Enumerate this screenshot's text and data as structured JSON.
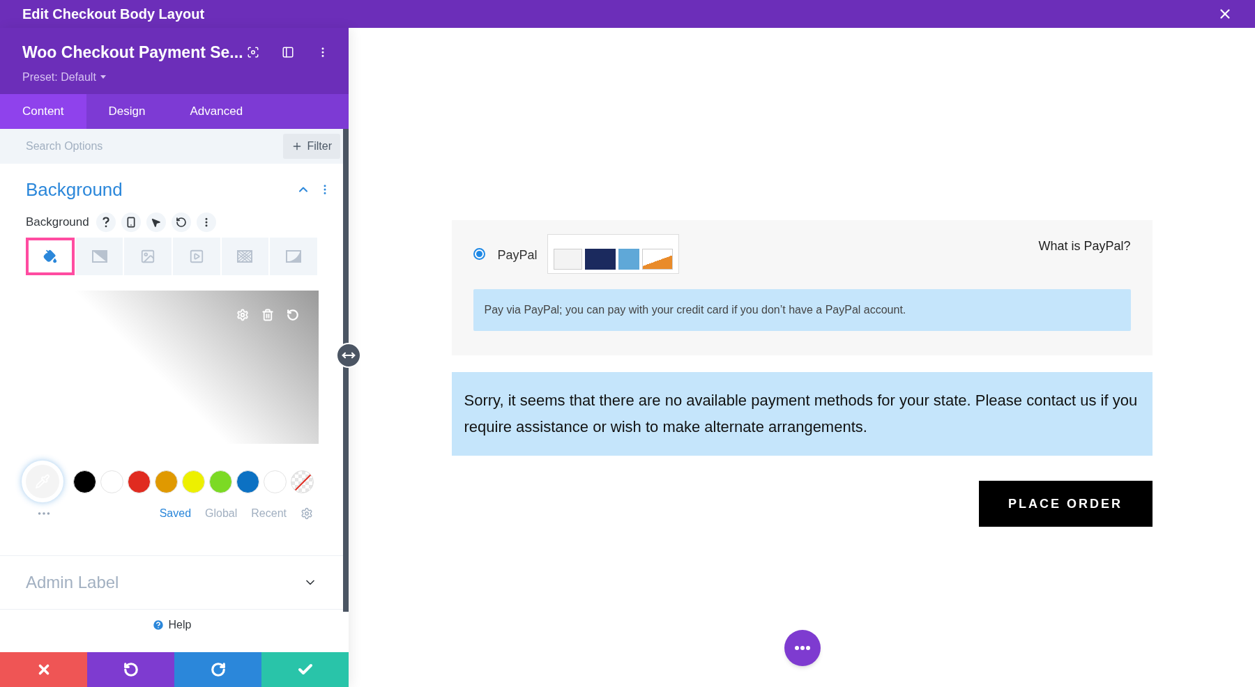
{
  "window": {
    "title": "Edit Checkout Body Layout"
  },
  "module": {
    "title": "Woo Checkout Payment Se...",
    "preset": "Preset: Default"
  },
  "tabs": [
    {
      "label": "Content",
      "selected": true
    },
    {
      "label": "Design",
      "selected": false
    },
    {
      "label": "Advanced",
      "selected": false
    }
  ],
  "search": {
    "placeholder": "Search Options",
    "filter_button": "Filter"
  },
  "background_section": {
    "title": "Background",
    "expanded": true,
    "field_label": "Background",
    "type_tabs": [
      {
        "kind": "color",
        "selected": true
      },
      {
        "kind": "gradient",
        "selected": false
      },
      {
        "kind": "image",
        "selected": false
      },
      {
        "kind": "video",
        "selected": false
      },
      {
        "kind": "pattern",
        "selected": false
      },
      {
        "kind": "mask",
        "selected": false
      }
    ],
    "swatches": [
      {
        "kind": "color",
        "color": "#000000"
      },
      {
        "kind": "color",
        "color": "#ffffff"
      },
      {
        "kind": "color",
        "color": "#e02b20"
      },
      {
        "kind": "color",
        "color": "#e09900"
      },
      {
        "kind": "color",
        "color": "#edf000"
      },
      {
        "kind": "color",
        "color": "#7cda24"
      },
      {
        "kind": "color",
        "color": "#0c71c3"
      },
      {
        "kind": "color",
        "color": "#ffffff"
      },
      {
        "kind": "none"
      }
    ],
    "palette_tabs": [
      {
        "label": "Saved",
        "selected": true
      },
      {
        "label": "Global",
        "selected": false
      },
      {
        "label": "Recent",
        "selected": false
      }
    ]
  },
  "admin_label": {
    "title": "Admin Label",
    "expanded": false
  },
  "help": "Help",
  "preview": {
    "payment_methods": [
      {
        "label": "PayPal",
        "selected": true,
        "link": "What is PayPal?",
        "description": "Pay via PayPal; you can pay with your credit card if you don’t have a PayPal account."
      }
    ],
    "notice": "Sorry, it seems that there are no available payment methods for your state. Please contact us if you require assistance or wish to make alternate arrangements.",
    "place_order": "PLACE ORDER"
  }
}
